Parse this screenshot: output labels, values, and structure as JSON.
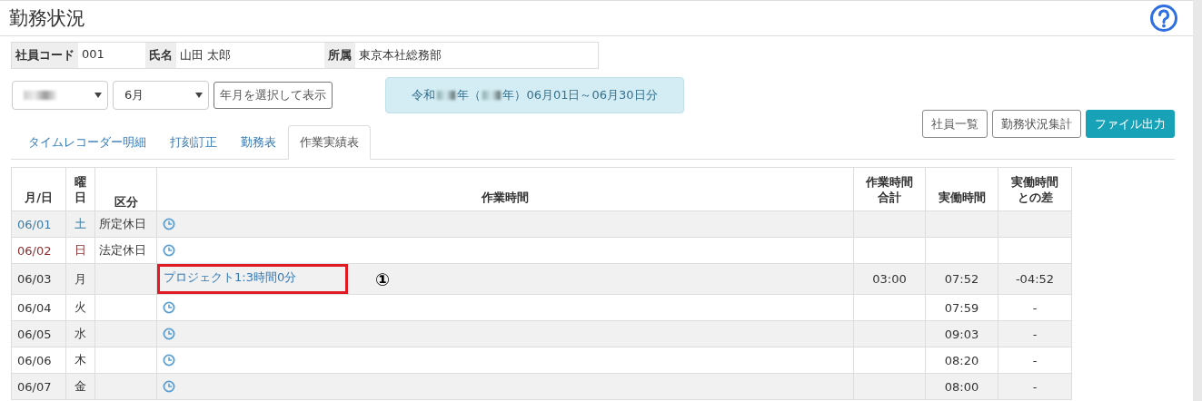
{
  "title": "勤務状況",
  "employee": [
    {
      "label": "社員コード",
      "value": "001"
    },
    {
      "label": "氏名",
      "value": "山田 太郎"
    },
    {
      "label": "所属",
      "value": "東京本社総務部"
    }
  ],
  "year_select": {
    "redacted": true
  },
  "month_select": {
    "value": "6月"
  },
  "show_button": "年月を選択して表示",
  "period": {
    "parts": [
      "令和",
      "年（",
      "年）06月01日～06月30日分"
    ]
  },
  "action_buttons": [
    {
      "label": "社員一覧",
      "kind": "outline"
    },
    {
      "label": "勤務状況集計",
      "kind": "outline"
    },
    {
      "label": "ファイル出力",
      "kind": "primary"
    }
  ],
  "tabs": [
    {
      "label": "タイムレコーダー明細",
      "selected": false
    },
    {
      "label": "打刻訂正",
      "selected": false
    },
    {
      "label": "勤務表",
      "selected": false
    },
    {
      "label": "作業実績表",
      "selected": true
    }
  ],
  "table": {
    "columns": [
      "月/日",
      "曜日",
      "区分",
      "作業時間",
      "作業時間合計",
      "実働時間",
      "実働時間との差"
    ],
    "rows": [
      {
        "date": "06/01",
        "weekday": "土",
        "color": "#3a7ca5",
        "category": "所定休日",
        "work": null,
        "total": "",
        "actual": "",
        "diff": ""
      },
      {
        "date": "06/02",
        "weekday": "日",
        "color": "#8b2e2e",
        "category": "法定休日",
        "work": null,
        "total": "",
        "actual": "",
        "diff": ""
      },
      {
        "date": "06/03",
        "weekday": "月",
        "color": "#333333",
        "category": "",
        "work": "プロジェクト1:3時間0分",
        "highlighted": true,
        "annotation": "①",
        "total": "03:00",
        "actual": "07:52",
        "diff": "-04:52"
      },
      {
        "date": "06/04",
        "weekday": "火",
        "color": "#333333",
        "category": "",
        "work": null,
        "total": "",
        "actual": "07:59",
        "diff": "-"
      },
      {
        "date": "06/05",
        "weekday": "水",
        "color": "#333333",
        "category": "",
        "work": null,
        "total": "",
        "actual": "09:03",
        "diff": "-"
      },
      {
        "date": "06/06",
        "weekday": "木",
        "color": "#333333",
        "category": "",
        "work": null,
        "total": "",
        "actual": "08:20",
        "diff": "-"
      },
      {
        "date": "06/07",
        "weekday": "金",
        "color": "#333333",
        "category": "",
        "work": null,
        "total": "",
        "actual": "08:00",
        "diff": "-"
      }
    ]
  }
}
